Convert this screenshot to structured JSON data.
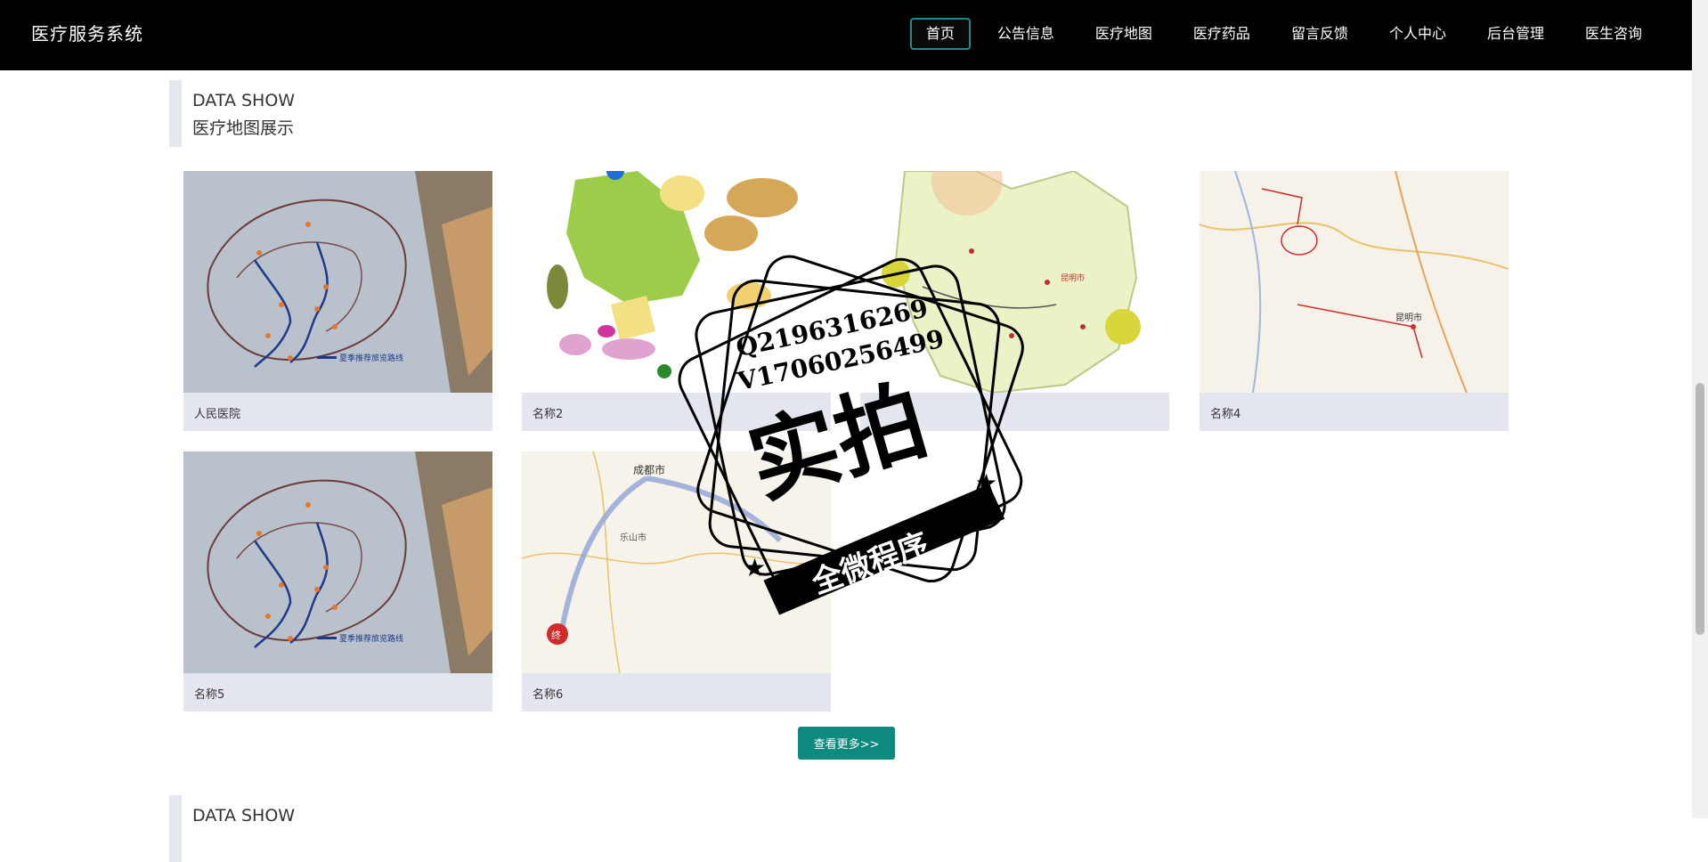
{
  "header": {
    "brand": "医疗服务系统",
    "nav": [
      "首页",
      "公告信息",
      "医疗地图",
      "医疗药品",
      "留言反馈",
      "个人中心",
      "后台管理",
      "医生咨询"
    ],
    "active_nav": "首页"
  },
  "section1": {
    "title_en": "DATA SHOW",
    "title_cn": "医疗地图展示"
  },
  "cards": [
    {
      "name": "人民医院",
      "map": "mountain-route-map"
    },
    {
      "name": "名称2",
      "map": "district-color-map"
    },
    {
      "name": "",
      "map": "province-city-map"
    },
    {
      "name": "名称4",
      "map": "road-route-map"
    },
    {
      "name": "名称5",
      "map": "mountain-route-map"
    },
    {
      "name": "名称6",
      "map": "sichuan-route-map"
    }
  ],
  "more_button": "查看更多>>",
  "section2": {
    "title_en": "DATA SHOW"
  },
  "watermark": {
    "line1": "Q2196316269",
    "line2": "V17060256499",
    "big": "实拍",
    "banner": "全微程序"
  },
  "colors": {
    "header_bg": "#000000",
    "accent": "#0f8a7f",
    "card_bg": "#e3e6ee"
  }
}
